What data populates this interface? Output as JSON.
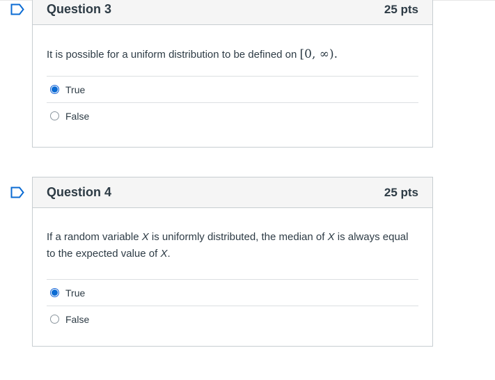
{
  "questions": [
    {
      "title": "Question 3",
      "points": "25 pts",
      "text_before": "It is possible for a uniform distribution to be defined on ",
      "math": "[0, ∞).",
      "answers": [
        {
          "label": "True",
          "selected": true
        },
        {
          "label": "False",
          "selected": false
        }
      ]
    },
    {
      "title": "Question 4",
      "points": "25 pts",
      "text_part1": "If a random variable ",
      "var1": "X",
      "text_part2": " is uniformly distributed, the median of ",
      "var2": "X",
      "text_part3": " is always equal to the expected value of ",
      "var3": "X",
      "text_part4": ".",
      "answers": [
        {
          "label": "True",
          "selected": true
        },
        {
          "label": "False",
          "selected": false
        }
      ]
    }
  ],
  "colors": {
    "accent": "#0b6bd3",
    "flag": "#0b6bd3",
    "header_bg": "#f5f5f5",
    "border": "#c7cdd1"
  },
  "icons": {
    "flag": "bookmark-flag-icon"
  }
}
